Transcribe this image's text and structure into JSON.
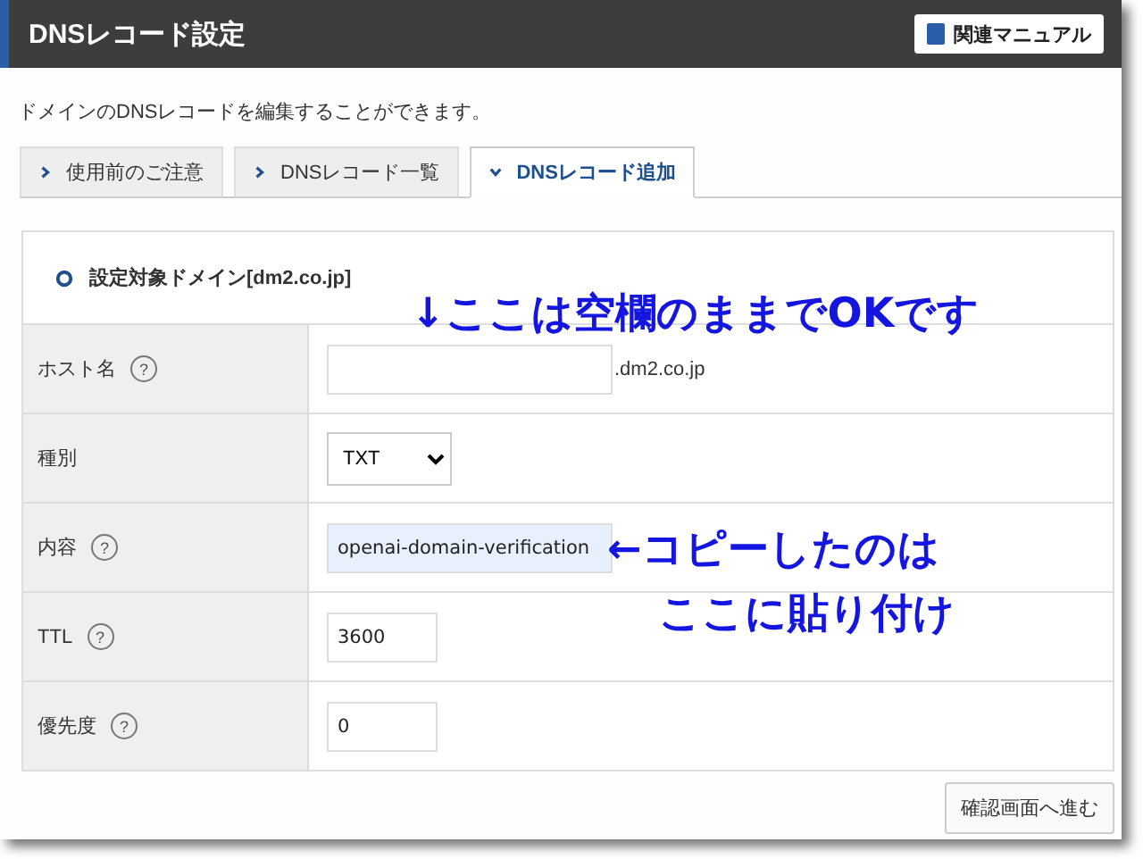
{
  "header": {
    "title": "DNSレコード設定",
    "manual_button": "関連マニュアル"
  },
  "description": "ドメインのDNSレコードを編集することができます。",
  "tabs": [
    {
      "label": "使用前のご注意",
      "selected": false
    },
    {
      "label": "DNSレコード一覧",
      "selected": false
    },
    {
      "label": "DNSレコード追加",
      "selected": true
    }
  ],
  "section_title": "設定対象ドメイン[dm2.co.jp]",
  "fields": [
    {
      "label": "ホスト名",
      "help": "?",
      "kind": "text",
      "suffix": ".dm2.co.jp"
    },
    {
      "label": "種別",
      "kind": "select",
      "value": "TXT"
    },
    {
      "label": "内容",
      "help": "?",
      "kind": "text",
      "value": "openai-domain-verification",
      "highlighted": true
    },
    {
      "label": "TTL",
      "help": "?",
      "kind": "number",
      "value": "3600"
    },
    {
      "label": "優先度",
      "help": "?",
      "kind": "number",
      "value": "0"
    }
  ],
  "annotations": [
    "↓ここは空欄のままでOKです",
    "←コピーしたのは",
    "ここに貼り付け"
  ],
  "submit_button": "確認画面へ進む"
}
